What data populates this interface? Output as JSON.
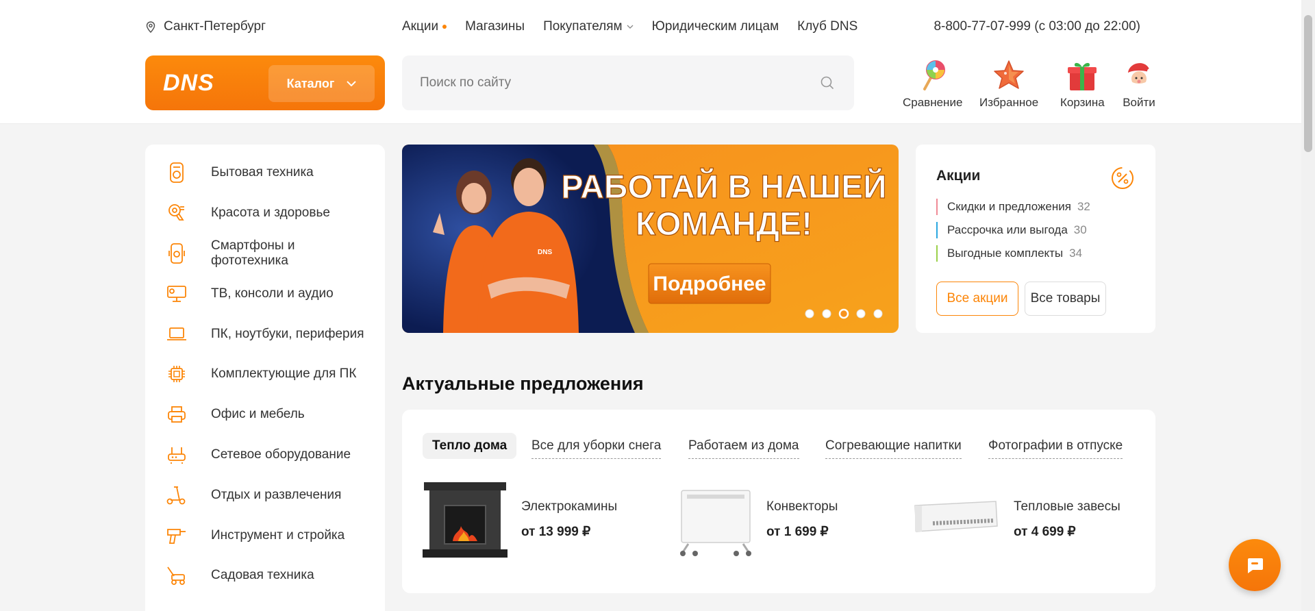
{
  "header": {
    "city": "Санкт-Петербург",
    "nav": [
      {
        "label": "Акции",
        "dot": true
      },
      {
        "label": "Магазины"
      },
      {
        "label": "Покупателям",
        "chevron": true
      },
      {
        "label": "Юридическим лицам"
      },
      {
        "label": "Клуб DNS"
      }
    ],
    "phone": "8-800-77-07-999 (с 03:00 до 22:00)",
    "logo": "DNS",
    "catalog_label": "Каталог",
    "search_placeholder": "Поиск по сайту",
    "icons": {
      "compare": "Сравнение",
      "favorites": "Избранное",
      "cart": "Корзина",
      "login": "Войти"
    }
  },
  "sidebar": {
    "items": [
      {
        "label": "Бытовая техника",
        "icon": "appliance-icon"
      },
      {
        "label": "Красота и здоровье",
        "icon": "hairdryer-icon"
      },
      {
        "label": "Смартфоны и\nфототехника",
        "icon": "smartphone-icon"
      },
      {
        "label": "ТВ, консоли и аудио",
        "icon": "tv-icon"
      },
      {
        "label": "ПК, ноутбуки, периферия",
        "icon": "laptop-icon"
      },
      {
        "label": "Комплектующие для ПК",
        "icon": "chip-icon"
      },
      {
        "label": "Офис и мебель",
        "icon": "printer-icon"
      },
      {
        "label": "Сетевое оборудование",
        "icon": "router-icon"
      },
      {
        "label": "Отдых и развлечения",
        "icon": "scooter-icon"
      },
      {
        "label": "Инструмент и стройка",
        "icon": "drill-icon"
      },
      {
        "label": "Садовая техника",
        "icon": "lawnmower-icon"
      }
    ]
  },
  "banner": {
    "line1": "РАБОТАЙ В НАШЕЙ",
    "line2": "КОМАНДЕ!",
    "button": "Подробнее",
    "shirt_logo": "DNS",
    "slides": 5,
    "active_slide": 3
  },
  "promos": {
    "title": "Акции",
    "items": [
      {
        "label": "Скидки и предложения",
        "count": "32",
        "color": "#f08a96"
      },
      {
        "label": "Рассрочка или выгода",
        "count": "30",
        "color": "#2aa7e0"
      },
      {
        "label": "Выгодные комплекты",
        "count": "34",
        "color": "#9bd04a"
      }
    ],
    "all_promos": "Все акции",
    "all_goods": "Все товары"
  },
  "offers": {
    "title": "Актуальные предложения",
    "tabs": [
      "Тепло дома",
      "Все для уборки снега",
      "Работаем из дома",
      "Согревающие напитки",
      "Фотографии в отпуске"
    ],
    "active_tab": 0,
    "products": [
      {
        "name": "Электрокамины",
        "price": "от 13 999 ₽"
      },
      {
        "name": "Конвекторы",
        "price": "от 1 699 ₽"
      },
      {
        "name": "Тепловые завесы",
        "price": "от 4 699 ₽"
      }
    ]
  },
  "colors": {
    "accent": "#fc8507"
  }
}
